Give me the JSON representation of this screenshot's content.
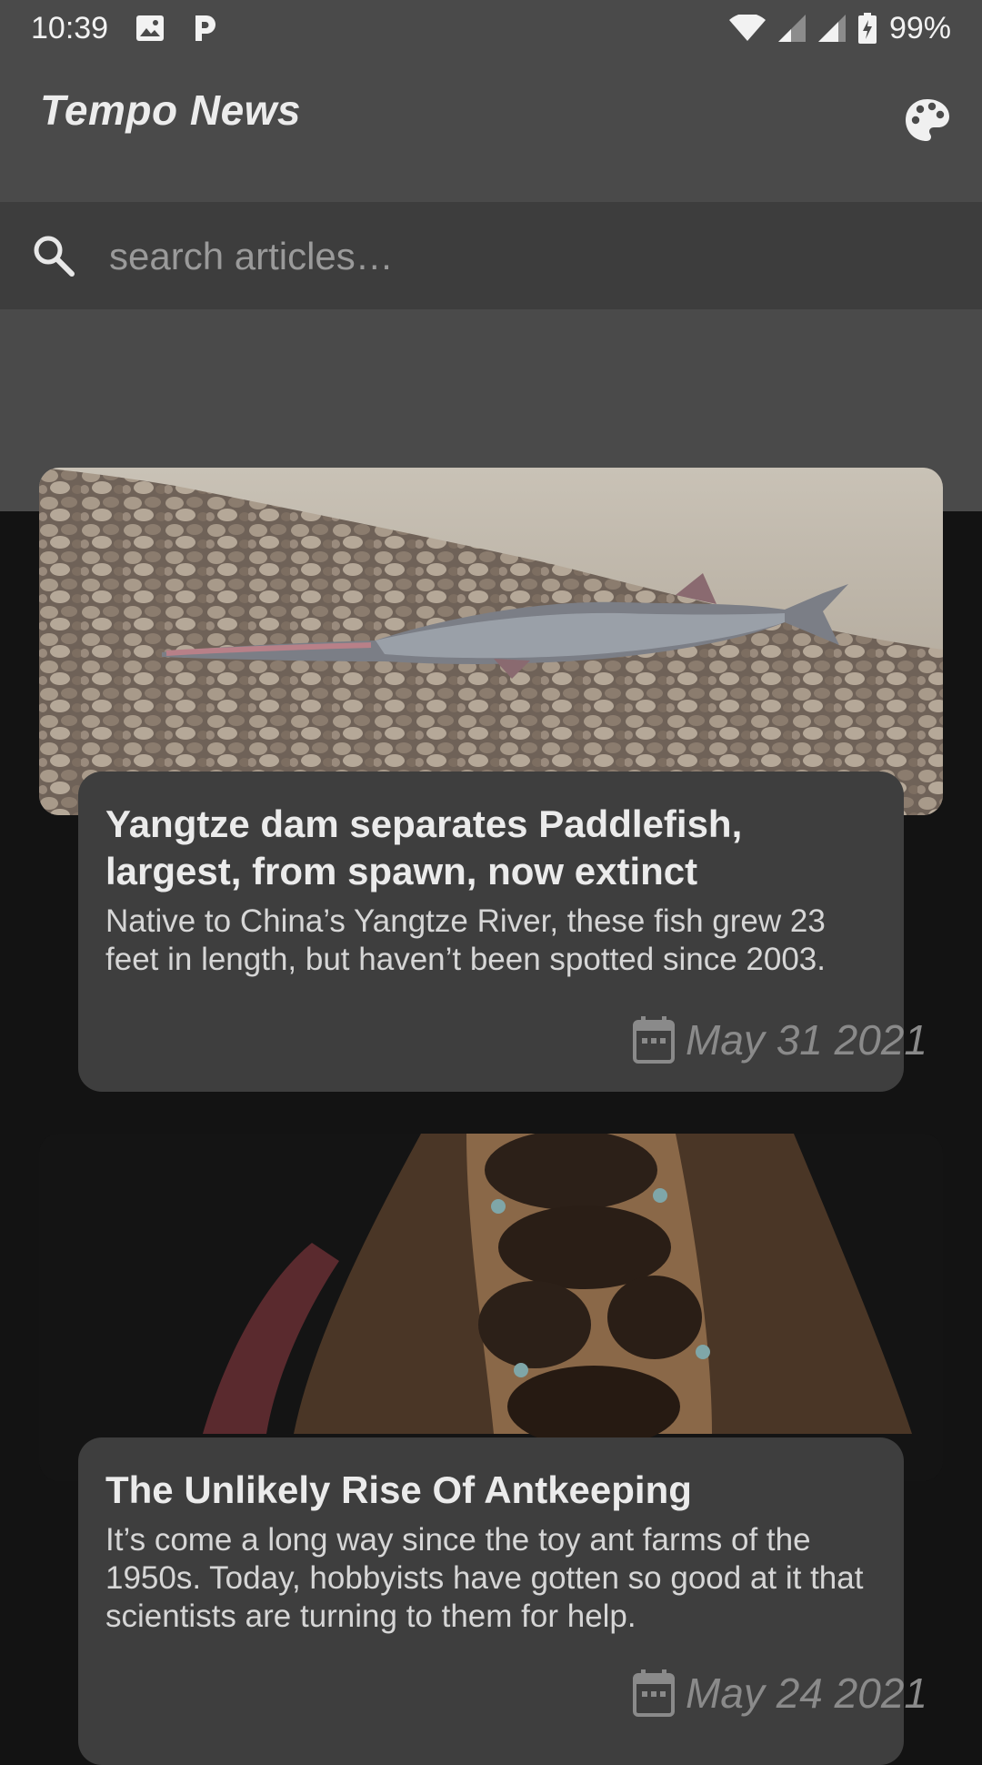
{
  "status_bar": {
    "time": "10:39",
    "battery": "99%",
    "icons": [
      "image-icon",
      "parking-icon",
      "wifi-icon",
      "signal-icon",
      "signal-icon",
      "battery-charging-icon"
    ]
  },
  "app_bar": {
    "title": "Tempo News",
    "action_icon": "palette-icon"
  },
  "search": {
    "placeholder": "search articles…",
    "value": ""
  },
  "articles": [
    {
      "title": "Yangtze dam separates Paddlefish, largest, from spawn, now extinct",
      "description": "Native to China’s Yangtze River, these fish grew 23 feet in length, but haven’t been spotted since 2003.",
      "date": "May 31 2021"
    },
    {
      "title": "The Unlikely Rise Of Antkeeping",
      "description": "It’s come a long way since the toy ant farms of the 1950s. Today, hobbyists have gotten so good at it that scientists are turning to them for help.",
      "date": "May 24 2021"
    }
  ],
  "colors": {
    "bar": "#4a4a4a",
    "search_bg": "#3d3d3d",
    "background": "#131313",
    "card": "#3e3e3e",
    "date": "#8a8a8a"
  }
}
